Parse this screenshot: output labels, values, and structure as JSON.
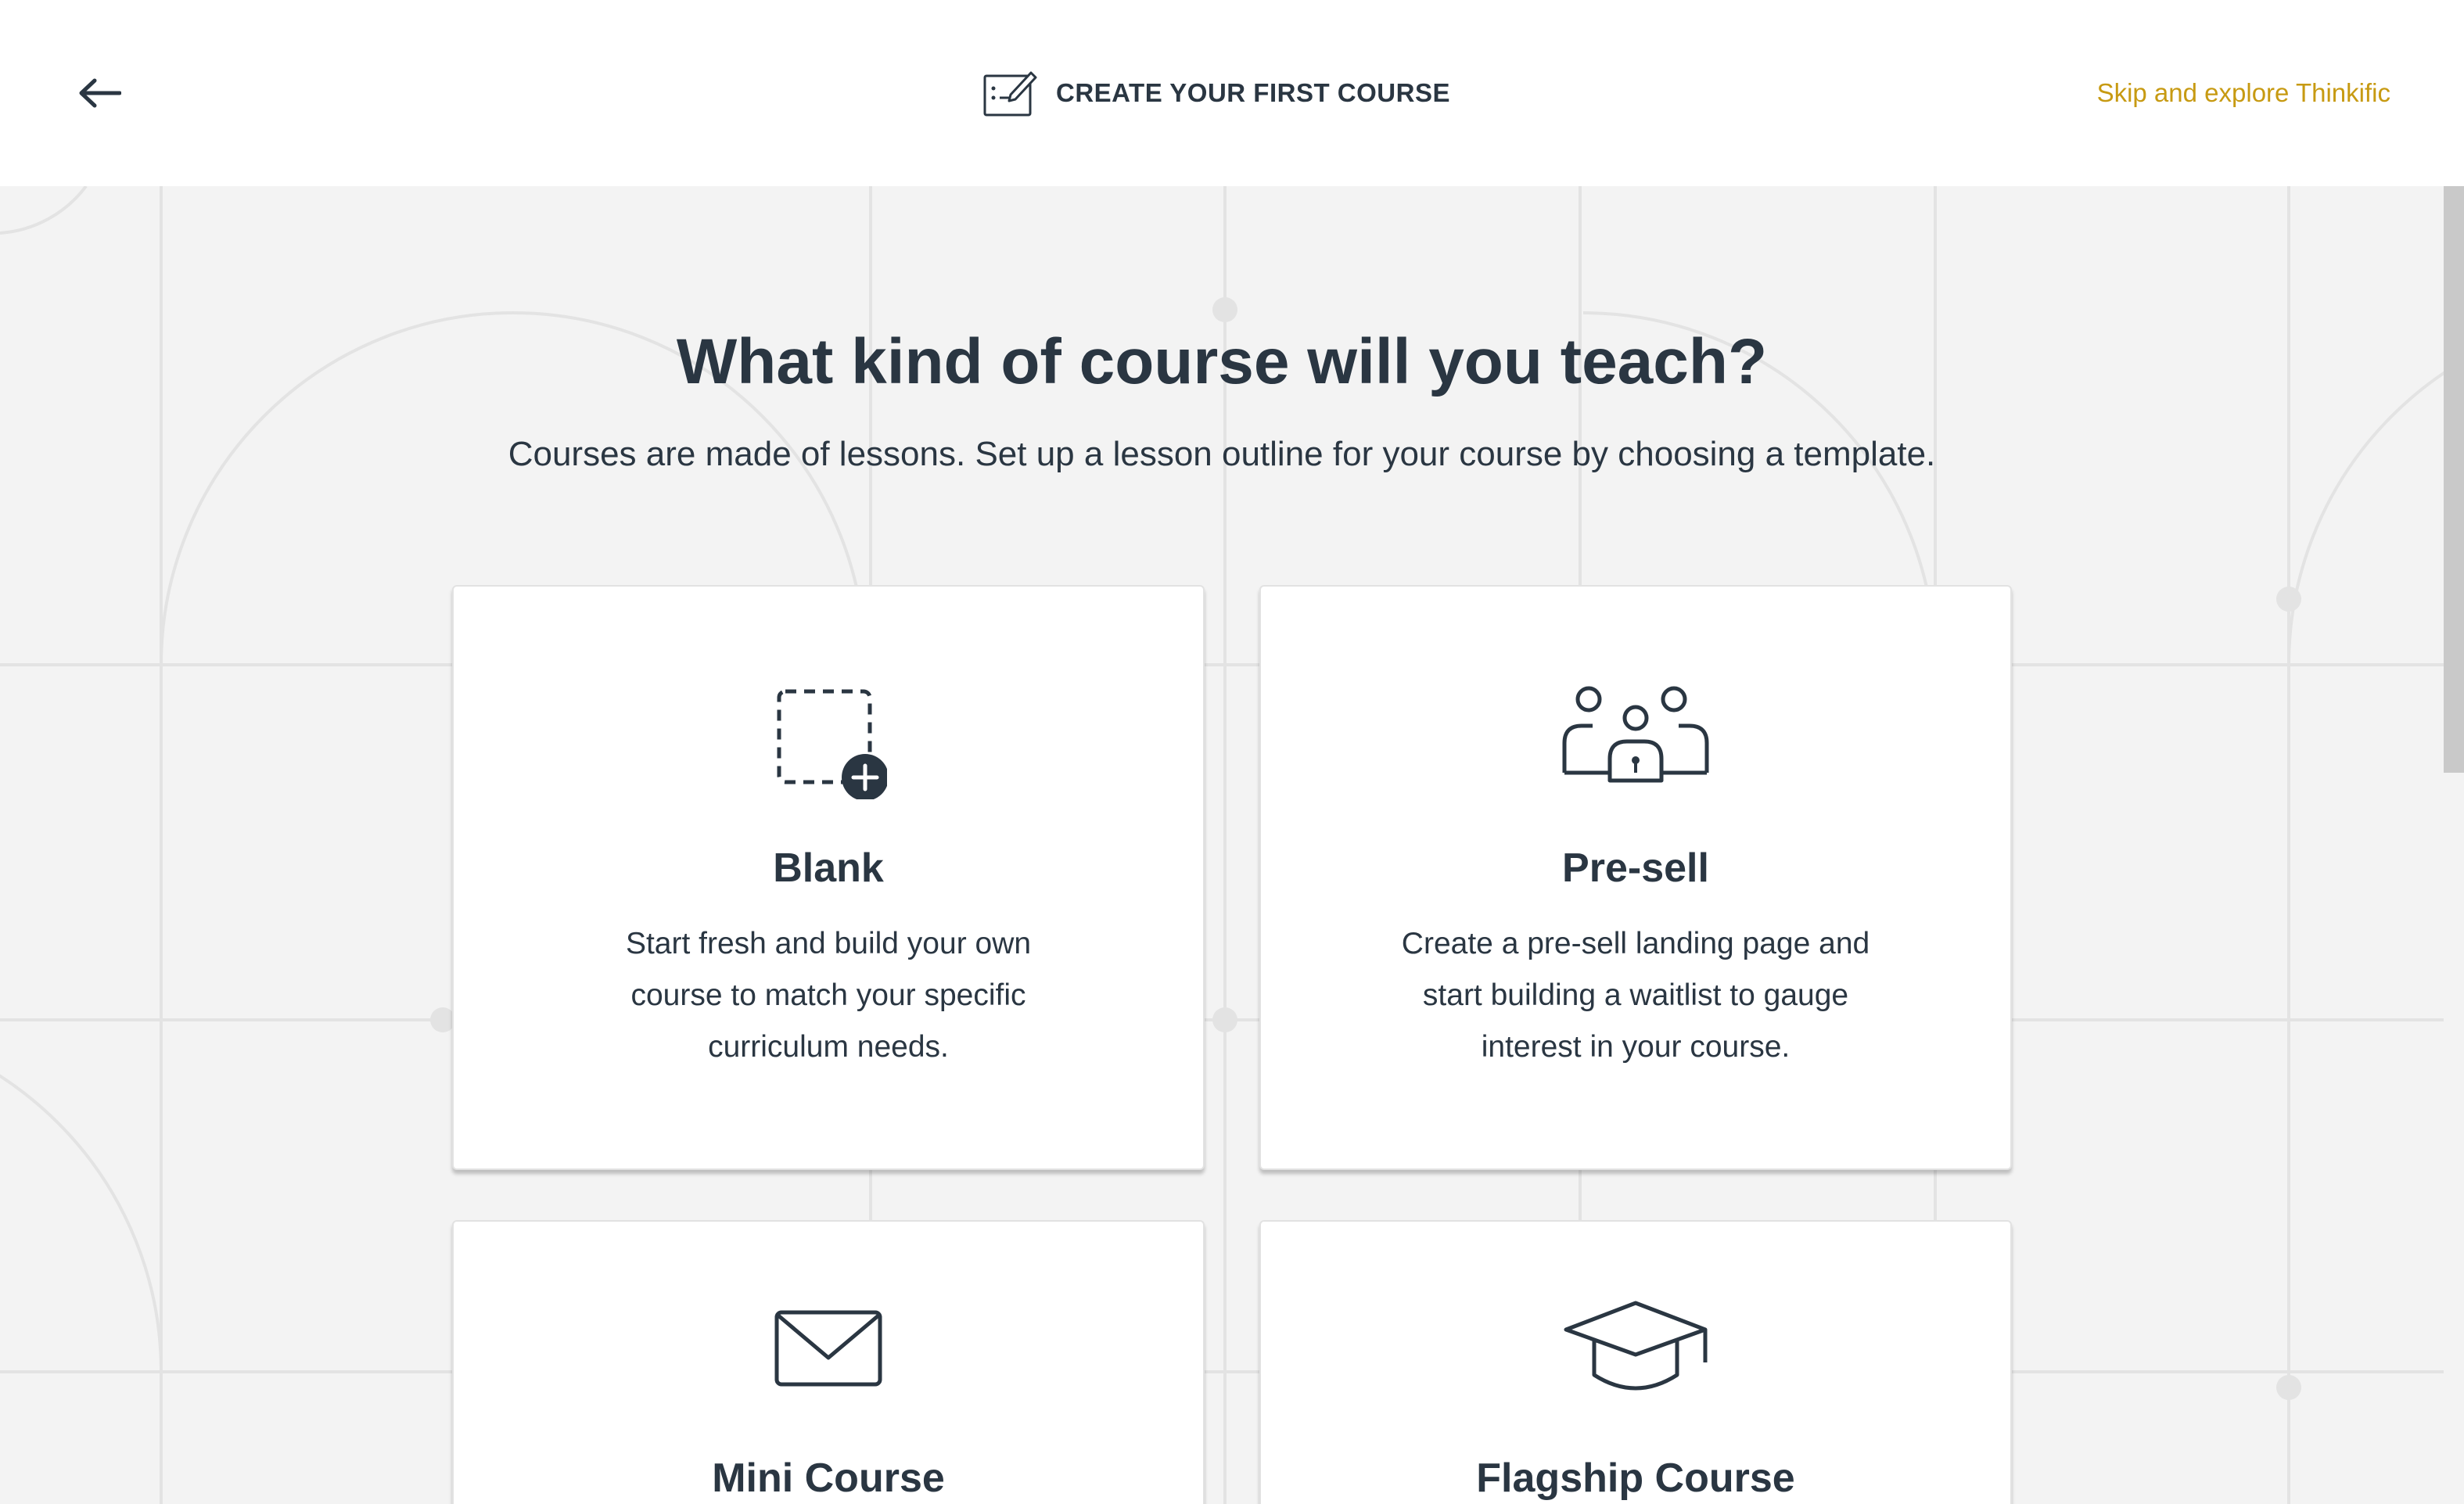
{
  "header": {
    "title": "CREATE YOUR FIRST COURSE",
    "skip_label": "Skip and explore Thinkific"
  },
  "main": {
    "heading": "What kind of course will you teach?",
    "subheading": "Courses are made of lessons. Set up a lesson outline for your course by choosing a template."
  },
  "cards": [
    {
      "title": "Blank",
      "description": "Start fresh and build your own course to match your specific curriculum needs.",
      "icon": "blank-add-icon"
    },
    {
      "title": "Pre-sell",
      "description": "Create a pre-sell landing page and start building a waitlist to gauge interest in your course.",
      "icon": "presell-people-icon"
    },
    {
      "title": "Mini Course",
      "icon": "envelope-icon"
    },
    {
      "title": "Flagship Course",
      "icon": "graduation-cap-icon"
    }
  ],
  "colors": {
    "text": "#2a3642",
    "accent": "#c79a12",
    "background": "#f3f3f3"
  }
}
